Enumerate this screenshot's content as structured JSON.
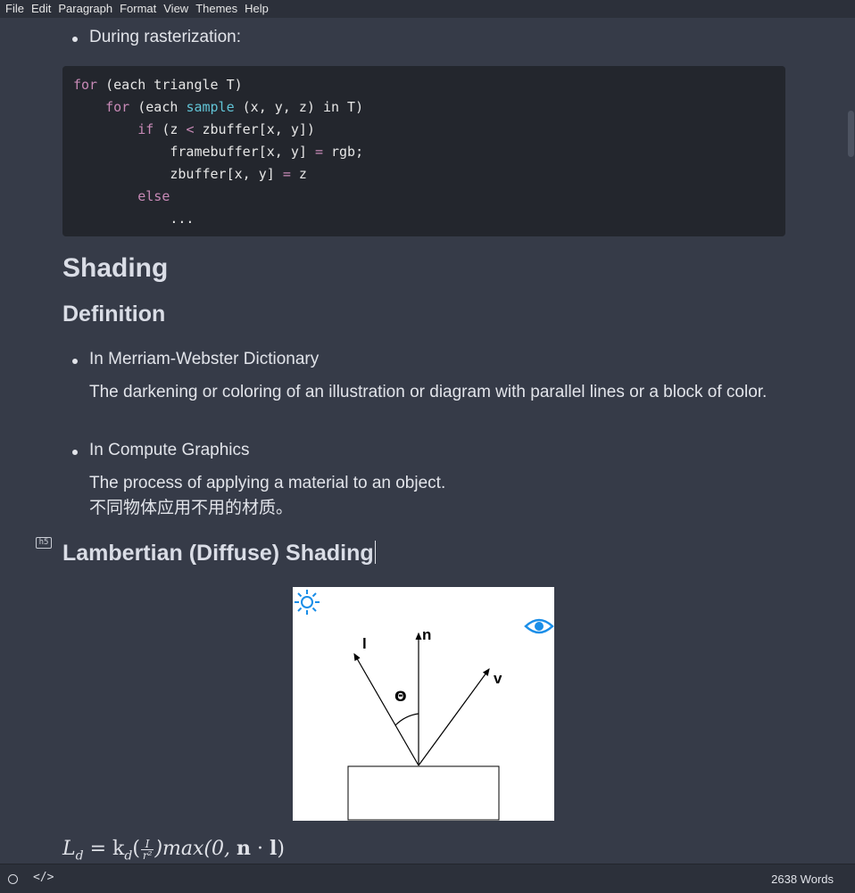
{
  "menu": [
    "File",
    "Edit",
    "Paragraph",
    "Format",
    "View",
    "Themes",
    "Help"
  ],
  "doc": {
    "bullet_raster": "During rasterization:",
    "code": {
      "l1_kw": "for",
      "l1_rest": " (each triangle T)",
      "l2_kw": "for",
      "l2_a": " (each ",
      "l2_fn": "sample",
      "l2_b": " (x, y, z) in T)",
      "l3_kw": "if",
      "l3_a": " (z ",
      "l3_op": "<",
      "l3_b": " zbuffer[x, y])",
      "l4_a": "framebuffer[x, y] ",
      "l4_op": "=",
      "l4_b": " rgb;",
      "l5_a": "zbuffer[x, y] ",
      "l5_op": "=",
      "l5_b": " z",
      "l6_kw": "else",
      "l7": "..."
    },
    "h_shading": "Shading",
    "h_definition": "Definition",
    "bullet_mw": "In Merriam-Webster Dictionary",
    "para_mw": "The darkening or coloring of an illustration or diagram with parallel lines or a block of color.",
    "bullet_cg": "In Compute Graphics",
    "para_cg_1": "The process of applying a material to an object.",
    "para_cg_2": "不同物体应用不用的材质。",
    "h5_badge": "h5",
    "h_lambert": "Lambertian (Diffuse) Shading",
    "figure": {
      "label_l": "l",
      "label_n": "n",
      "label_v": "v",
      "label_theta": "Θ",
      "light_icon": "sun-icon",
      "viewer_icon": "eye-icon"
    },
    "formula": {
      "L": "L",
      "d1": "d",
      "eq": " = k",
      "d2": "d",
      "open": "(",
      "num": "I",
      "den": "r²",
      "close": ")max(0, ",
      "n": "n",
      "dot": " · ",
      "l": "l",
      "end": ")"
    }
  },
  "status": {
    "word_count": "2638 Words",
    "source_icon": "</>"
  }
}
